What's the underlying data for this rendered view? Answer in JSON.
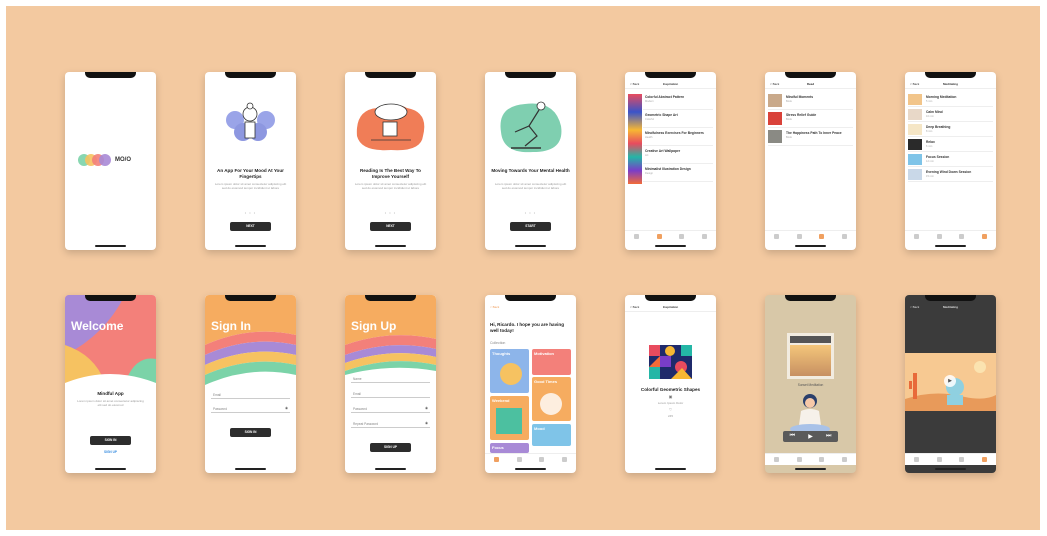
{
  "colors": {
    "background": "#f3c9a0",
    "accent": "#f0a060",
    "dark": "#2d2d2d"
  },
  "screens": {
    "splash": {
      "logo_text": "MO/O"
    },
    "onboard1": {
      "title": "An App For Your Mood At Your Fingertips",
      "body": "Lorem ipsum dolor sit amet consectetur adipiscing elit sed do eiusmod tempor incididunt ut labore",
      "button": "NEXT"
    },
    "onboard2": {
      "title": "Reading Is The Best Way To Improve Yourself",
      "body": "Lorem ipsum dolor sit amet consectetur adipiscing elit sed do eiusmod tempor incididunt ut labore",
      "button": "NEXT"
    },
    "onboard3": {
      "title": "Moving Towards Your Mental Health",
      "body": "Lorem ipsum dolor sit amet consectetur adipiscing elit sed do eiusmod tempor incididunt ut labore",
      "button": "START"
    },
    "list1": {
      "back": "< Back",
      "title": "Inspiration",
      "items": [
        {
          "t": "Colorful Abstract Pattern",
          "s": "Modern"
        },
        {
          "t": "Geometric Shape Art",
          "s": "Colorful"
        },
        {
          "t": "Mindfulness Exercises For Beginners",
          "s": "Health"
        },
        {
          "t": "Creative Art Wallpaper",
          "s": "Art"
        },
        {
          "t": "Minimalist Illustration Design",
          "s": "Design"
        }
      ]
    },
    "list2": {
      "back": "< Back",
      "title": "Read",
      "items": [
        {
          "t": "Mindful Moments",
          "s": "Book"
        },
        {
          "t": "Stress Relief Guide",
          "s": "Book"
        },
        {
          "t": "The Happiness Path To Inner Peace",
          "s": "Book"
        }
      ]
    },
    "list3": {
      "back": "< Back",
      "title": "Meditating",
      "items": [
        {
          "t": "Morning Meditation",
          "s": "5 min"
        },
        {
          "t": "Calm Mind",
          "s": "10 min"
        },
        {
          "t": "Deep Breathing",
          "s": "8 min"
        },
        {
          "t": "Relax",
          "s": "6 min"
        },
        {
          "t": "Focus Session",
          "s": "12 min"
        },
        {
          "t": "Evening Wind Down Session",
          "s": "15 min"
        }
      ]
    },
    "welcome": {
      "title": "Welcome",
      "subtitle": "Mindful App",
      "body": "Lorem ipsum dolor sit amet consectetur adipiscing elit sed do eiusmod",
      "button": "SIGN IN",
      "link": "SIGN UP"
    },
    "signin": {
      "title": "Sign In",
      "email": "Email",
      "password": "Password",
      "button": "SIGN IN"
    },
    "signup": {
      "title": "Sign Up",
      "name": "Name",
      "email": "Email",
      "password": "Password",
      "confirm": "Repeat Password",
      "button": "SIGN UP"
    },
    "home": {
      "back": "< Back",
      "greeting": "Hi, Ricardo. I hope you are having well today!",
      "section": "Collection",
      "cards": [
        "Thoughts",
        "Motivation",
        "Good Times",
        "Weekend",
        "Mood",
        "Focus"
      ]
    },
    "detail": {
      "back": "< Back",
      "title": "Inspiration",
      "item_title": "Colorful Geometric Shapes",
      "meta": "Lorem Ipsum Dolor",
      "likes": "245"
    },
    "player": {
      "title": "Sunset Meditation"
    },
    "video": {
      "back": "< Back",
      "title": "Meditating"
    }
  }
}
